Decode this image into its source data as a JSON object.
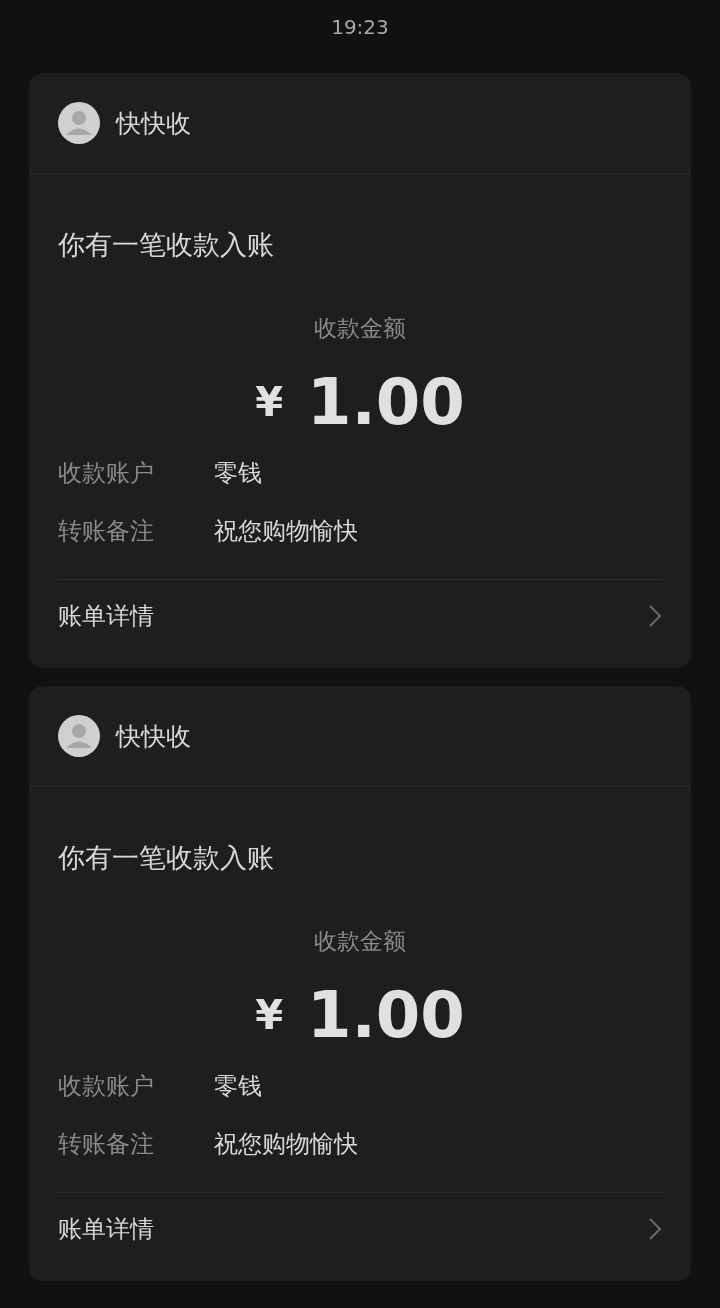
{
  "status_bar": {
    "time": "19:23"
  },
  "cards": [
    {
      "sender": "快快收",
      "title": "你有一笔收款入账",
      "amount_label": "收款金额",
      "currency": "¥",
      "amount": "1.00",
      "fields": [
        {
          "label": "收款账户",
          "value": "零钱"
        },
        {
          "label": "转账备注",
          "value": "祝您购物愉快"
        }
      ],
      "footer": "账单详情"
    },
    {
      "sender": "快快收",
      "title": "你有一笔收款入账",
      "amount_label": "收款金额",
      "currency": "¥",
      "amount": "1.00",
      "fields": [
        {
          "label": "收款账户",
          "value": "零钱"
        },
        {
          "label": "转账备注",
          "value": "祝您购物愉快"
        }
      ],
      "footer": "账单详情"
    }
  ]
}
